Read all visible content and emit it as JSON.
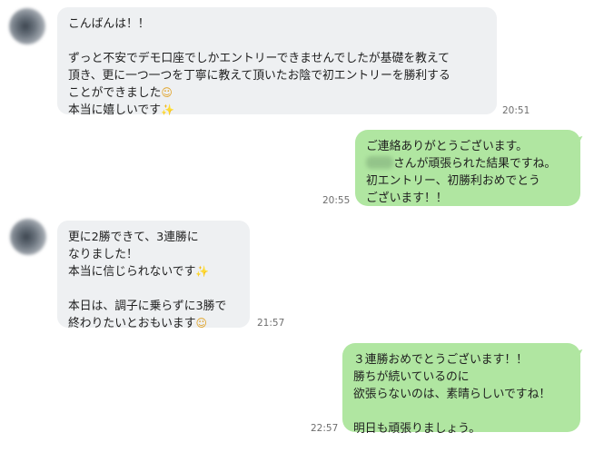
{
  "messages": [
    {
      "side": "incoming",
      "lines": [
        "こんばんは！！",
        "",
        "ずっと不安でデモ口座でしかエントリーできませんでしたが基礎を教えて",
        "頂き、更に一つ一つを丁寧に教えて頂いたお陰で初エントリーを勝利する",
        "ことができました",
        "本当に嬉しいです"
      ],
      "time": "20:51"
    },
    {
      "side": "outgoing",
      "line1": "ご連絡ありがとうございます。",
      "line2_suffix": "さんが頑張られた結果ですね。",
      "line3": "初エントリー、初勝利おめでとう",
      "line4": "ございます！！",
      "time": "20:55"
    },
    {
      "side": "incoming",
      "lines": [
        "更に2勝できて、3連勝に",
        "なりました！",
        "本当に信じられないです",
        "",
        "本日は、調子に乗らずに3勝で",
        "終わりたいとおもいます"
      ],
      "time": "21:57"
    },
    {
      "side": "outgoing",
      "lines": [
        "３連勝おめでとうございます！！",
        "勝ちが続いているのに",
        "欲張らないのは、素晴らしいですね！",
        "",
        "明日も頑張りましょう。"
      ],
      "time": "22:57"
    }
  ],
  "icons": {
    "smile": "☺",
    "sparkle": "✨"
  },
  "colors": {
    "incoming_bubble": "#eef0f2",
    "outgoing_bubble": "#b0e6a1",
    "timestamp": "#6e6e6e"
  }
}
